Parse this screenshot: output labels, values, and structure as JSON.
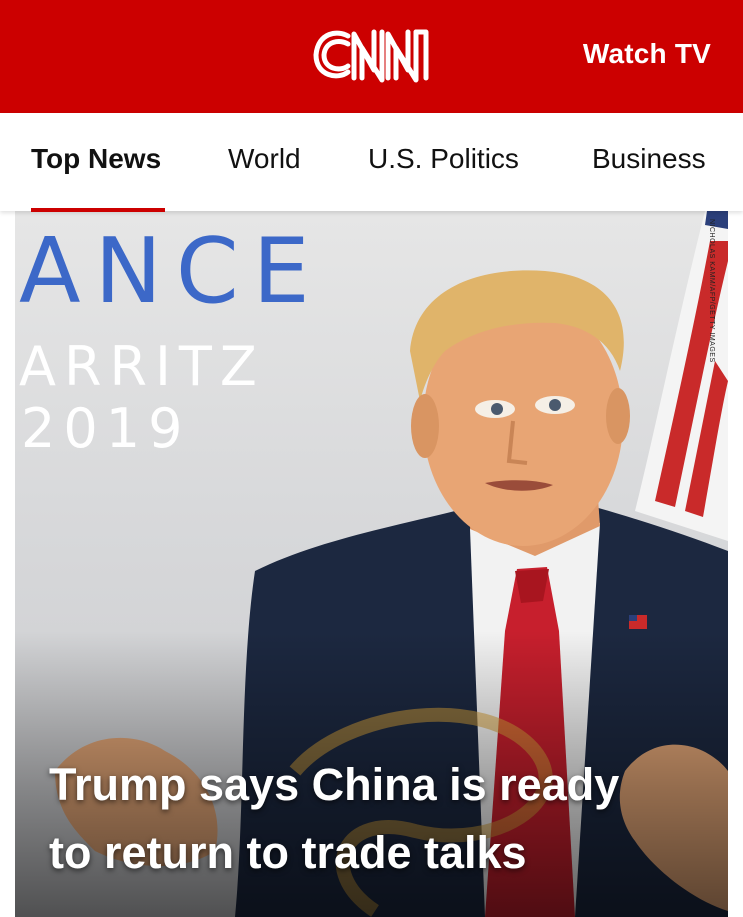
{
  "header": {
    "logo_text": "CNN",
    "watch_label": "Watch TV",
    "bg_color": "#cc0000"
  },
  "nav": {
    "tabs": [
      {
        "label": "Top News",
        "active": true
      },
      {
        "label": "World",
        "active": false
      },
      {
        "label": "U.S. Politics",
        "active": false
      },
      {
        "label": "Business",
        "active": false
      }
    ]
  },
  "hero": {
    "backdrop_text": {
      "line1": "ANCE",
      "line2": "ARRITZ",
      "line3": "2019"
    },
    "photo_credit": "NICHOLAS KAMM/AFP/GETTY IMAGES",
    "headline_line1": "Trump says China is ready",
    "headline_line2": "to return to trade talks"
  }
}
